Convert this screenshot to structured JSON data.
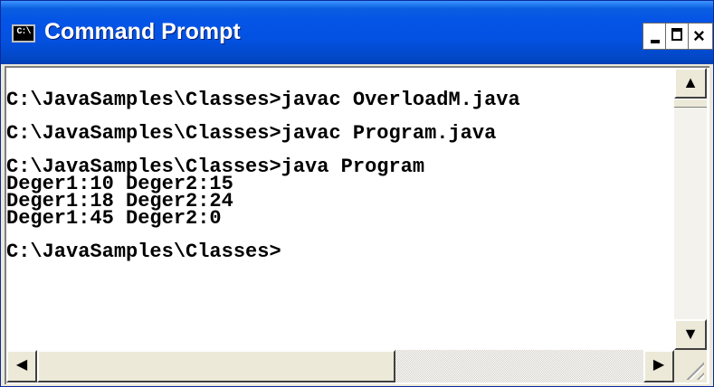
{
  "window": {
    "title": "Command Prompt",
    "icon": "cmd-icon",
    "icon_text": "C:\\",
    "controls": {
      "minimize": "minimize-icon",
      "maximize": "maximize-icon",
      "close": "close-icon",
      "close_glyph": "×"
    }
  },
  "console": {
    "lines": [
      "C:\\JavaSamples\\Classes>javac OverloadM.java",
      "",
      "C:\\JavaSamples\\Classes>javac Program.java",
      "",
      "C:\\JavaSamples\\Classes>java Program",
      "Deger1:10 Deger2:15",
      "Deger1:18 Deger2:24",
      "Deger1:45 Deger2:0",
      "",
      "C:\\JavaSamples\\Classes>"
    ]
  },
  "scrollbars": {
    "up_glyph": "▲",
    "down_glyph": "▼",
    "left_glyph": "◀",
    "right_glyph": "▶"
  },
  "colors": {
    "titlebar": "#0454e6",
    "console_bg": "#ffffff",
    "console_text": "#000000"
  }
}
